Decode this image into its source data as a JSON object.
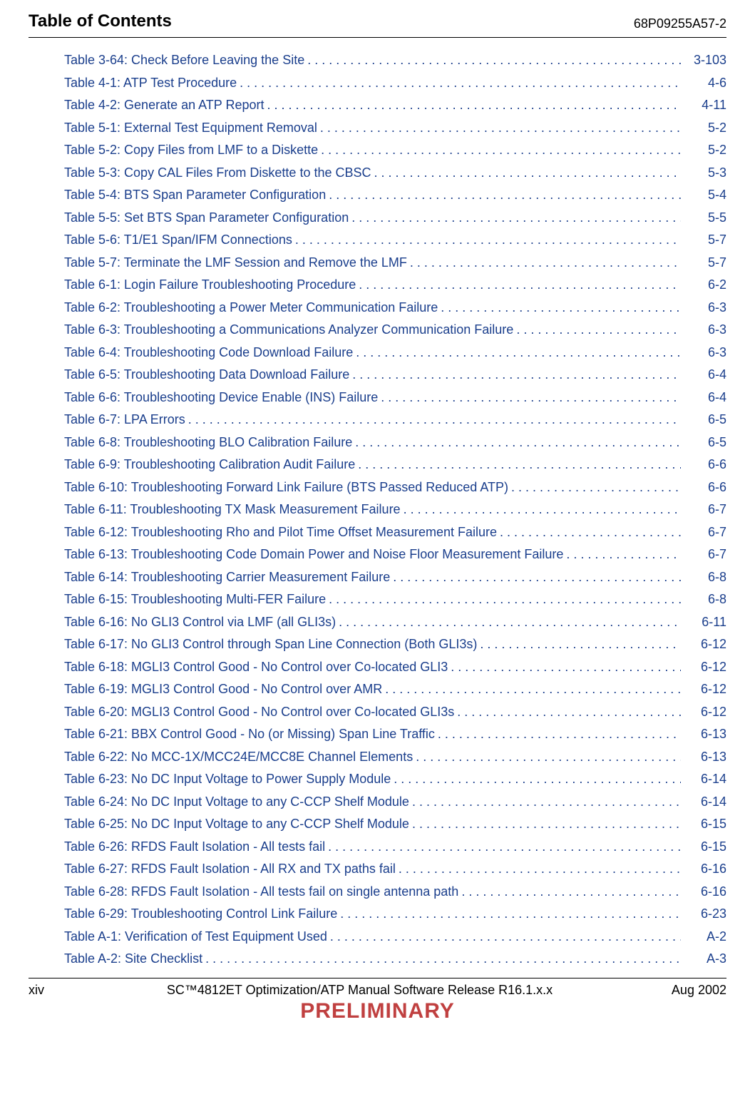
{
  "header": {
    "left": "Table of Contents",
    "right": "68P09255A57-2"
  },
  "toc": [
    {
      "label": "Table 3-64: Check Before Leaving the Site",
      "page": "3-103"
    },
    {
      "label": "Table 4-1:  ATP Test Procedure",
      "page": "4-6"
    },
    {
      "label": "Table 4-2:  Generate an ATP  Report",
      "page": "4-11"
    },
    {
      "label": "Table 5-1: External Test Equipment Removal",
      "page": "5-2"
    },
    {
      "label": "Table 5-2: Copy Files from LMF to a Diskette",
      "page": "5-2"
    },
    {
      "label": "Table 5-3: Copy CAL Files From Diskette to the CBSC",
      "page": "5-3"
    },
    {
      "label": "Table 5-4: BTS Span Parameter Configuration",
      "page": "5-4"
    },
    {
      "label": "Table 5-5: Set BTS Span Parameter Configuration",
      "page": "5-5"
    },
    {
      "label": "Table 5-6: T1/E1 Span/IFM Connections",
      "page": "5-7"
    },
    {
      "label": "Table 5-7: Terminate the LMF Session and Remove the LMF",
      "page": "5-7"
    },
    {
      "label": "Table 6-1:  Login Failure Troubleshooting Procedure",
      "page": "6-2"
    },
    {
      "label": "Table 6-2:  Troubleshooting a Power Meter Communication Failure",
      "page": "6-3"
    },
    {
      "label": "Table 6-3:  Troubleshooting a Communications Analyzer Communication Failure",
      "page": "6-3"
    },
    {
      "label": "Table 6-4: Troubleshooting Code Download Failure",
      "page": "6-3"
    },
    {
      "label": "Table 6-5: Troubleshooting Data Download Failure",
      "page": "6-4"
    },
    {
      "label": "Table 6-6: Troubleshooting Device Enable (INS) Failure",
      "page": "6-4"
    },
    {
      "label": "Table 6-7: LPA Errors",
      "page": "6-5"
    },
    {
      "label": "Table 6-8: Troubleshooting BLO Calibration Failure",
      "page": "6-5"
    },
    {
      "label": "Table 6-9: Troubleshooting Calibration Audit Failure",
      "page": "6-6"
    },
    {
      "label": "Table 6-10: Troubleshooting Forward Link Failure (BTS Passed Reduced ATP)",
      "page": "6-6"
    },
    {
      "label": "Table 6-11: Troubleshooting TX Mask Measurement Failure",
      "page": "6-7"
    },
    {
      "label": "Table 6-12: Troubleshooting Rho and Pilot Time Offset Measurement Failure",
      "page": "6-7"
    },
    {
      "label": "Table 6-13: Troubleshooting Code Domain Power and Noise Floor Measurement Failure",
      "page": "6-7"
    },
    {
      "label": "Table 6-14: Troubleshooting Carrier Measurement Failure",
      "page": "6-8"
    },
    {
      "label": "Table 6-15: Troubleshooting Multi-FER Failure",
      "page": "6-8"
    },
    {
      "label": "Table 6-16: No GLI3 Control via LMF (all GLI3s)",
      "page": "6-11"
    },
    {
      "label": "Table 6-17: No GLI3 Control through Span Line Connection (Both GLI3s)",
      "page": "6-12"
    },
    {
      "label": "Table 6-18: MGLI3 Control Good - No Control over Co-located GLI3",
      "page": "6-12"
    },
    {
      "label": "Table 6-19: MGLI3 Control Good - No Control over AMR",
      "page": "6-12"
    },
    {
      "label": "Table 6-20: MGLI3 Control Good - No Control over Co-located GLI3s",
      "page": "6-12"
    },
    {
      "label": "Table 6-21: BBX Control Good - No (or Missing) Span Line Traffic",
      "page": "6-13"
    },
    {
      "label": "Table 6-22: No MCC-1X/MCC24E/MCC8E Channel Elements",
      "page": "6-13"
    },
    {
      "label": "Table 6-23: No DC Input Voltage to Power Supply Module",
      "page": "6-14"
    },
    {
      "label": "Table 6-24: No DC Input Voltage to any C-CCP Shelf Module",
      "page": "6-14"
    },
    {
      "label": "Table 6-25: No DC Input Voltage to any C-CCP Shelf Module",
      "page": "6-15"
    },
    {
      "label": "Table 6-26: RFDS Fault Isolation - All tests fail",
      "page": "6-15"
    },
    {
      "label": "Table 6-27: RFDS Fault Isolation - All RX and TX paths fail",
      "page": "6-16"
    },
    {
      "label": "Table 6-28: RFDS Fault Isolation - All tests fail on single antenna path",
      "page": "6-16"
    },
    {
      "label": "Table 6-29: Troubleshooting Control Link Failure",
      "page": "6-23"
    },
    {
      "label": "Table A-1: Verification of Test Equipment Used",
      "page": "A-2"
    },
    {
      "label": "Table A-2: Site Checklist",
      "page": "A-3"
    }
  ],
  "footer": {
    "page_roman": "xiv",
    "title": "SC™4812ET Optimization/ATP Manual Software Release R16.1.x.x",
    "date": "Aug 2002",
    "preliminary": "PRELIMINARY"
  }
}
